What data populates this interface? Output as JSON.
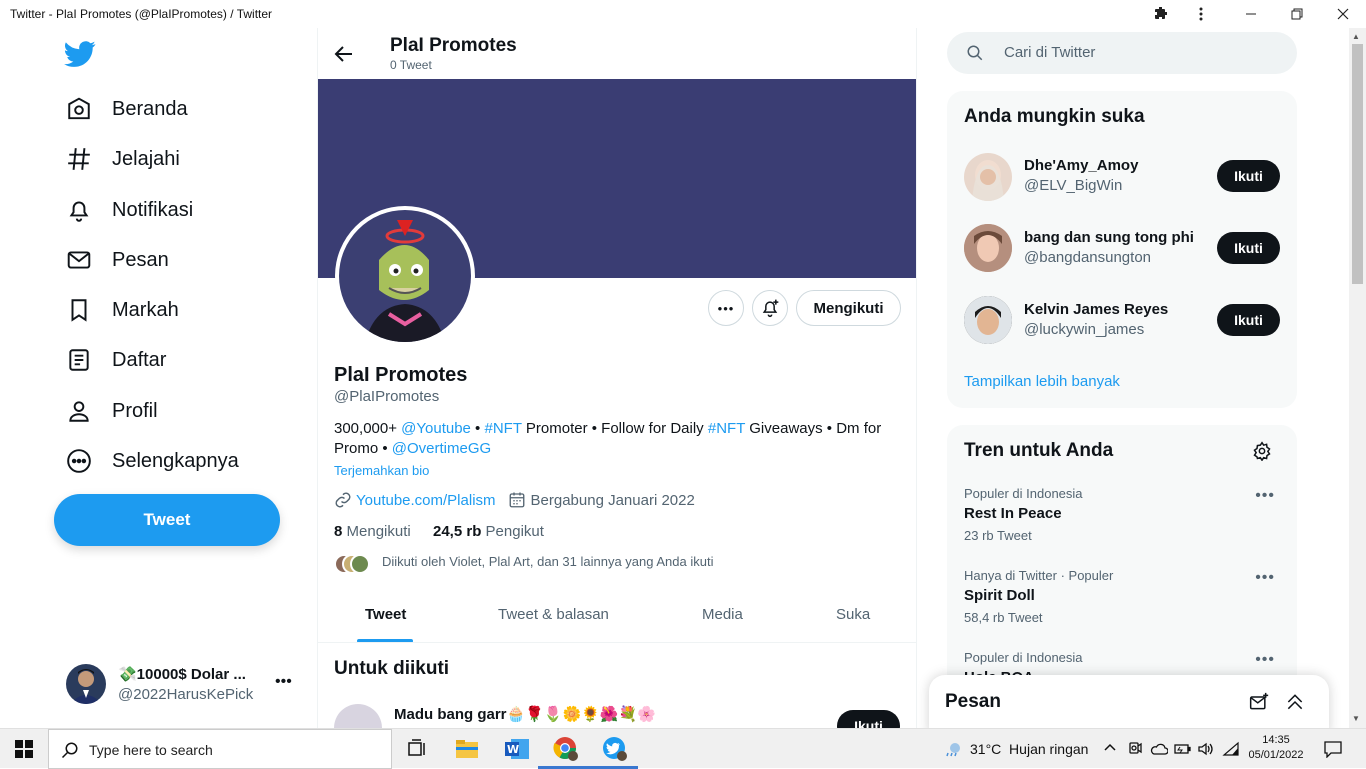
{
  "window": {
    "title": "Twitter - PlaI Promotes (@PlaIPromotes) / Twitter"
  },
  "nav": {
    "items": [
      {
        "label": "Beranda",
        "icon": "home-icon"
      },
      {
        "label": "Jelajahi",
        "icon": "hashtag-icon"
      },
      {
        "label": "Notifikasi",
        "icon": "bell-icon"
      },
      {
        "label": "Pesan",
        "icon": "mail-icon"
      },
      {
        "label": "Markah",
        "icon": "bookmark-icon"
      },
      {
        "label": "Daftar",
        "icon": "list-icon"
      },
      {
        "label": "Profil",
        "icon": "person-icon"
      },
      {
        "label": "Selengkapnya",
        "icon": "more-circle-icon"
      }
    ],
    "tweet_label": "Tweet",
    "account": {
      "name": "💸10000$ Dolar ...",
      "handle": "@2022HarusKePick"
    }
  },
  "header": {
    "title": "PlaI Promotes",
    "subtitle": "0 Tweet"
  },
  "profile": {
    "name": "PlaI Promotes",
    "handle": "@PlaIPromotes",
    "bio": {
      "t1": "300,000+ ",
      "l1": "@Youtube",
      "t2": " • ",
      "l2": "#NFT",
      "t3": " Promoter • Follow for Daily ",
      "l3": "#NFT",
      "t4": " Giveaways • Dm for Promo • ",
      "l4": "@OvertimeGG"
    },
    "translate": "Terjemahkan bio",
    "website": "Youtube.com/Plalism",
    "joined": "Bergabung Januari 2022",
    "following_count": "8",
    "following_label": "Mengikuti",
    "followers_count": "24,5 rb",
    "followers_label": "Pengikut",
    "followed_by": "Diikuti oleh Violet, Plal Art, dan 31 lainnya yang Anda ikuti",
    "following_button": "Mengikuti"
  },
  "tabs": [
    "Tweet",
    "Tweet & balasan",
    "Media",
    "Suka"
  ],
  "to_follow": {
    "title": "Untuk diikuti",
    "first_name": "Madu bang garr🧁🌹🌷🌼🌻🌺💐🌸",
    "button": "Ikuti"
  },
  "search": {
    "placeholder": "Cari di Twitter"
  },
  "suggestions": {
    "title": "Anda mungkin suka",
    "users": [
      {
        "name": "Dhe'Amy_Amoy",
        "handle": "@ELV_BigWin",
        "button": "Ikuti"
      },
      {
        "name": "bang dan sung tong phi",
        "handle": "@bangdansungton",
        "button": "Ikuti"
      },
      {
        "name": "Kelvin James Reyes",
        "handle": "@luckywin_james",
        "button": "Ikuti"
      }
    ],
    "show_more": "Tampilkan lebih banyak"
  },
  "trends": {
    "title": "Tren untuk Anda",
    "items": [
      {
        "meta": "Populer di Indonesia",
        "name": "Rest In Peace",
        "count": "23 rb Tweet"
      },
      {
        "meta": "Hanya di Twitter · Populer",
        "name": "Spirit Doll",
        "count": "58,4 rb Tweet"
      },
      {
        "meta": "Populer di Indonesia",
        "name": "Hole BOA",
        "count": ""
      }
    ]
  },
  "messages_dock": {
    "title": "Pesan"
  },
  "taskbar": {
    "search_placeholder": "Type here to search",
    "weather": "31°C  Hujan ringan",
    "time": "14:35",
    "date": "05/01/2022"
  },
  "colors": {
    "accent": "#1d9bf0",
    "banner": "#3a3d73",
    "text": "#0f1419",
    "muted": "#536471"
  }
}
